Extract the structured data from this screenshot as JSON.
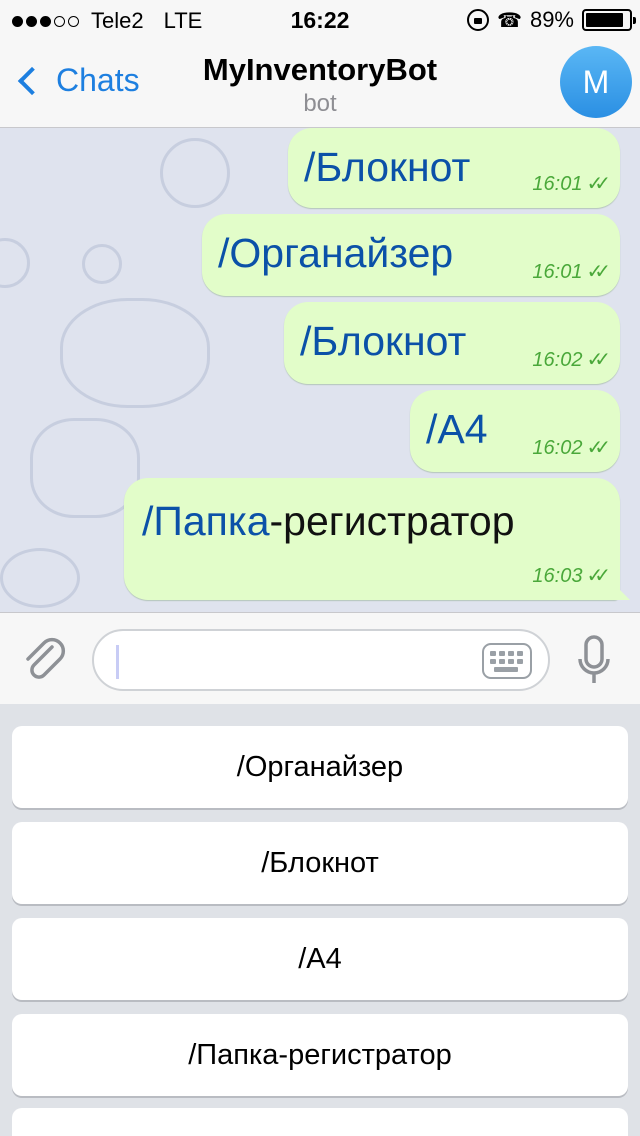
{
  "status_bar": {
    "carrier": "Tele2",
    "network": "LTE",
    "time": "16:22",
    "battery": "89%",
    "battery_level": 0.89,
    "signal_bars": 3,
    "signal_total": 5
  },
  "nav": {
    "back_label": "Chats",
    "title": "MyInventoryBot",
    "subtitle": "bot",
    "avatar_initial": "M"
  },
  "messages": [
    {
      "command": "/Блокнот",
      "rest": "",
      "time": "16:01",
      "read_marks": "✓✓"
    },
    {
      "command": "/Органайзер",
      "rest": "",
      "time": "16:01",
      "read_marks": "✓✓"
    },
    {
      "command": "/Блокнот",
      "rest": "",
      "time": "16:02",
      "read_marks": "✓✓"
    },
    {
      "command": "/A4",
      "rest": "",
      "time": "16:02",
      "read_marks": "✓✓"
    },
    {
      "command": "/Папка",
      "rest": "-регистратор",
      "time": "16:03",
      "read_marks": "✓✓"
    }
  ],
  "input": {
    "value": "",
    "placeholder": ""
  },
  "keyboard_buttons": [
    {
      "label": "/Органайзер"
    },
    {
      "label": "/Блокнот"
    },
    {
      "label": "/A4"
    },
    {
      "label": "/Папка-регистратор"
    }
  ],
  "icons": [
    "back-chevron-icon",
    "attach-icon",
    "keyboard-icon",
    "microphone-icon",
    "battery-icon",
    "rotation-lock-icon",
    "alarm-icon"
  ],
  "colors": {
    "accent": "#1d7fe0",
    "bubble": "#e2fdc9",
    "command_link": "#0b51a8",
    "read_check": "#4aa83a"
  }
}
